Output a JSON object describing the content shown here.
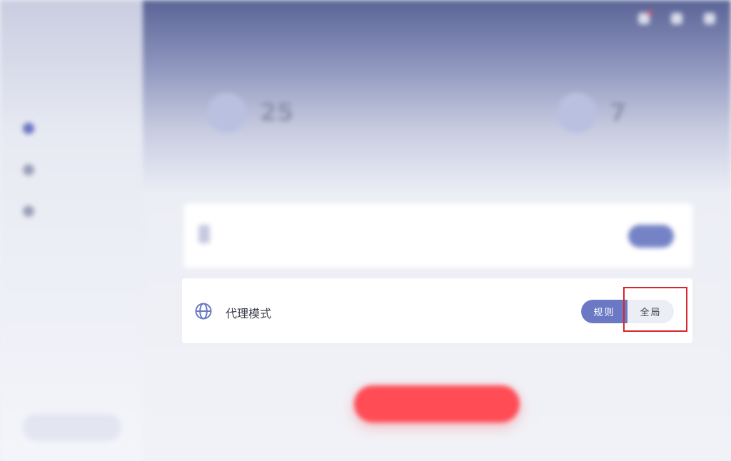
{
  "sidebar": {
    "brand": "",
    "items": [
      {
        "label": "",
        "active": true
      },
      {
        "label": "",
        "active": false
      },
      {
        "label": "",
        "active": false
      }
    ],
    "bottom_button": ""
  },
  "window": {
    "controls": [
      "notification-icon",
      "minimize-icon",
      "close-icon"
    ]
  },
  "stats": [
    {
      "label": "",
      "value": "25",
      "unit": ""
    },
    {
      "label": "",
      "value": "7",
      "unit": ""
    }
  ],
  "server_card": {
    "title": "",
    "subtitle": "",
    "button": ""
  },
  "proxy_mode": {
    "icon": "globe-icon",
    "label": "代理模式",
    "options": [
      "规则",
      "全局"
    ],
    "selected": "规则"
  },
  "connect_button": "",
  "colors": {
    "accent": "#6b79c4",
    "connect": "#ff4c55",
    "highlight": "#d9262c"
  }
}
